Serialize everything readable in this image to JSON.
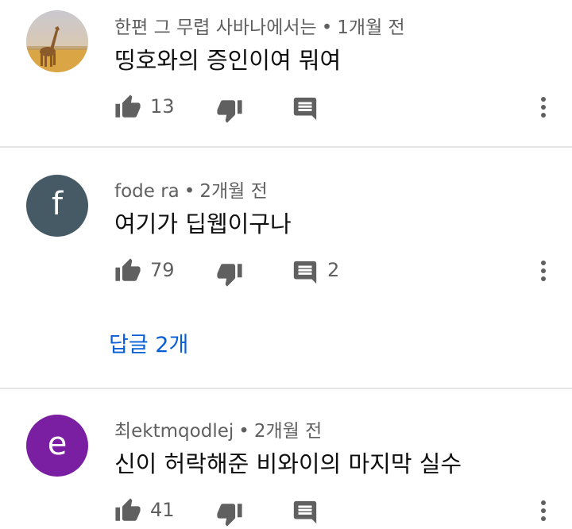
{
  "comments": [
    {
      "author": "한편 그 무렵 사바나에서는",
      "time": "1개월 전",
      "text": "띵호와의 증인이여 뭐여",
      "likes": "13",
      "reply_count": "",
      "avatar": {
        "type": "image",
        "description": "giraffe-on-savanna"
      }
    },
    {
      "author": "fode ra",
      "time": "2개월 전",
      "text": "여기가 딥웹이구나",
      "likes": "79",
      "reply_count": "2",
      "avatar": {
        "type": "letter",
        "letter": "f",
        "color": "#455a64"
      },
      "replies_link": "답글 2개"
    },
    {
      "author": "최ektmqodlej",
      "time": "2개월 전",
      "text": "신이 허락해준 비와이의 마지막 실수",
      "likes": "41",
      "reply_count": "",
      "avatar": {
        "type": "letter",
        "letter": "e",
        "color": "#7b1fa2"
      }
    }
  ],
  "separator": "•",
  "colors": {
    "meta": "#606060",
    "icon": "#606060",
    "link": "#065fd4",
    "divider": "#e5e5e5"
  }
}
